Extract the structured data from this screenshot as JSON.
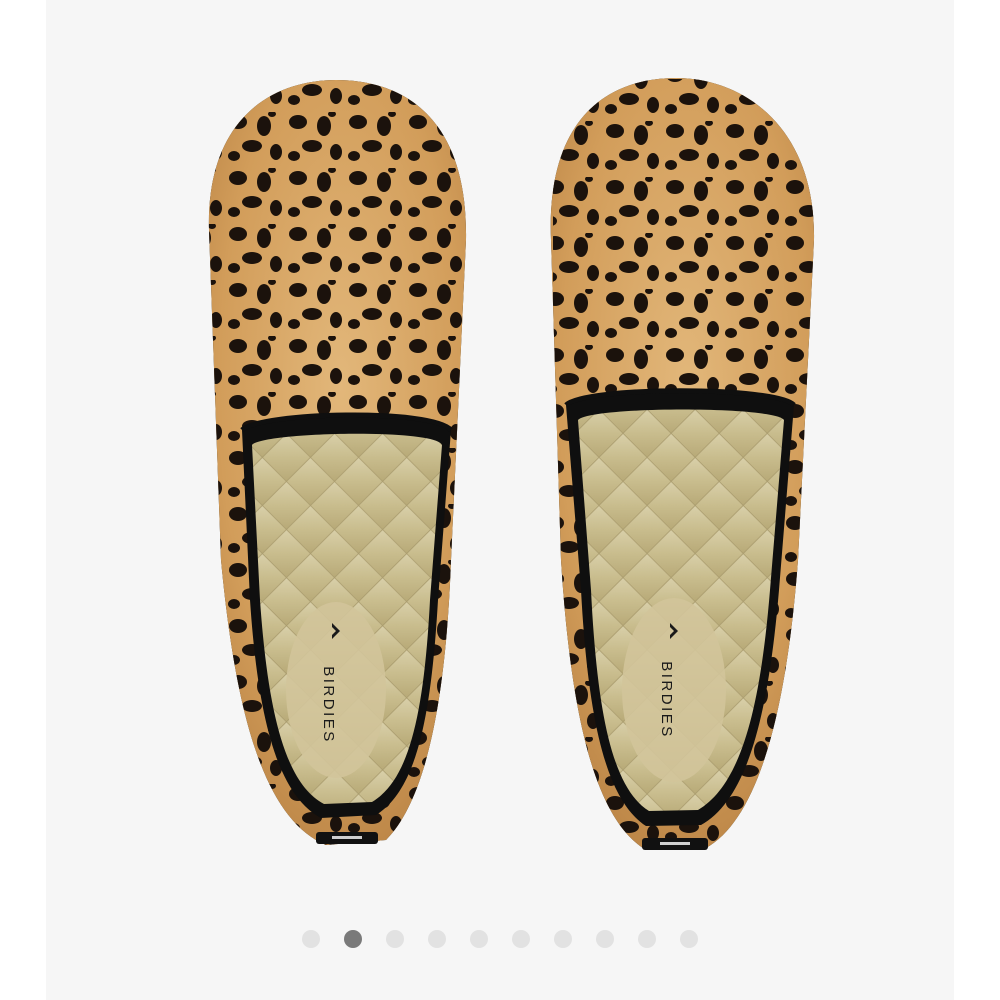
{
  "product": {
    "brand_label": "BIRDIES",
    "image_alt_icon": "leopard-print-loafers-image"
  },
  "carousel": {
    "total_slides": 10,
    "active_index": 1,
    "colors": {
      "dot_inactive": "#e2e2e2",
      "dot_active": "#7a7a7a",
      "background": "#f6f6f6"
    }
  }
}
